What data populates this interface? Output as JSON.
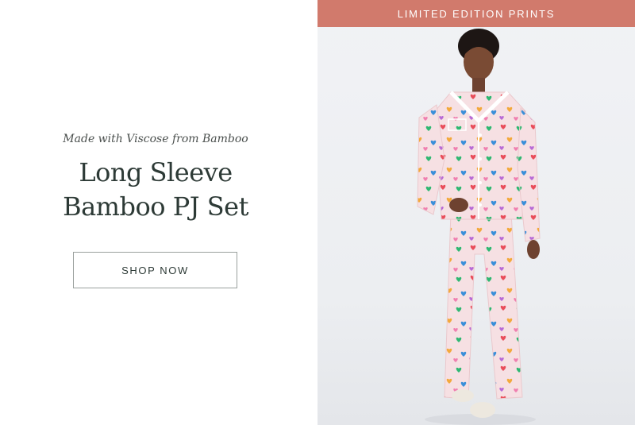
{
  "promo": {
    "tagline": "Made with Viscose from Bamboo",
    "headline_line1": "Long Sleeve",
    "headline_line2": "Bamboo PJ Set",
    "cta_label": "SHOP NOW"
  },
  "banner": {
    "label": "LIMITED EDITION PRINTS"
  },
  "product_image": {
    "subject": "model-wearing-heart-print-pajama-set",
    "print_colors": [
      "#e94d5a",
      "#2fb872",
      "#f3a93c",
      "#3a8fd9",
      "#b86ad6",
      "#f07fb0"
    ]
  },
  "colors": {
    "banner": "#d17a6c",
    "heading": "#2d3a36",
    "pajama": "#f5dfe1"
  }
}
